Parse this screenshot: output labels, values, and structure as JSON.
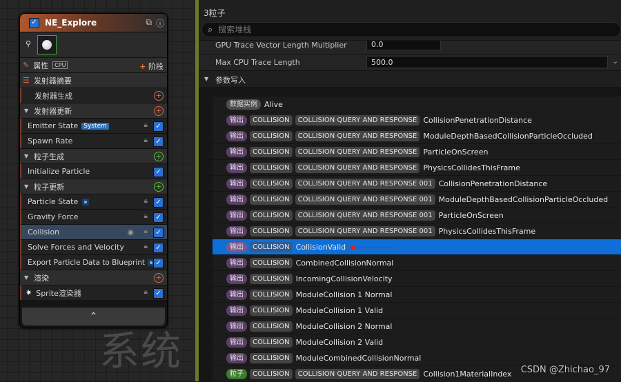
{
  "node": {
    "title": "NE_Explore",
    "properties_label": "属性",
    "cpu_label": "CPU",
    "stage_label": "阶段",
    "emitter_summary": "发射器摘要",
    "emitter_spawn": "发射器生成",
    "emitter_update": "发射器更新",
    "emitter_state": "Emitter State",
    "system_tag": "System",
    "spawn_rate": "Spawn Rate",
    "particle_spawn": "粒子生成",
    "initialize_particle": "Initialize Particle",
    "particle_update": "粒子更新",
    "particle_state": "Particle State",
    "gravity_force": "Gravity Force",
    "collision": "Collision",
    "solve_forces": "Solve Forces and Velocity",
    "export_particle": "Export Particle Data to Blueprint",
    "render": "渲染",
    "sprite_renderer": "Sprite渲染器"
  },
  "watermark": "系统",
  "panel": {
    "title": "3粒子",
    "search_placeholder": "搜索堆栈",
    "partial_label": "GPU Trace Vector Length Multiplier",
    "partial_value": "0.0",
    "max_cpu_label": "Max CPU Trace Length",
    "max_cpu_value": "500.0",
    "group_label": "参数写入"
  },
  "params": [
    {
      "ns": "数据实例",
      "cats": [],
      "name": "Alive"
    },
    {
      "ns": "输出",
      "cats": [
        "COLLISION",
        "COLLISION QUERY AND RESPONSE"
      ],
      "name": "CollisionPenetrationDistance"
    },
    {
      "ns": "输出",
      "cats": [
        "COLLISION",
        "COLLISION QUERY AND RESPONSE"
      ],
      "name": "ModuleDepthBasedCollisionParticleOccluded"
    },
    {
      "ns": "输出",
      "cats": [
        "COLLISION",
        "COLLISION QUERY AND RESPONSE"
      ],
      "name": "ParticleOnScreen"
    },
    {
      "ns": "输出",
      "cats": [
        "COLLISION",
        "COLLISION QUERY AND RESPONSE"
      ],
      "name": "PhysicsCollidesThisFrame"
    },
    {
      "ns": "输出",
      "cats": [
        "COLLISION",
        "COLLISION QUERY AND RESPONSE 001"
      ],
      "name": "CollisionPenetrationDistance"
    },
    {
      "ns": "输出",
      "cats": [
        "COLLISION",
        "COLLISION QUERY AND RESPONSE 001"
      ],
      "name": "ModuleDepthBasedCollisionParticleOccluded"
    },
    {
      "ns": "输出",
      "cats": [
        "COLLISION",
        "COLLISION QUERY AND RESPONSE 001"
      ],
      "name": "ParticleOnScreen"
    },
    {
      "ns": "输出",
      "cats": [
        "COLLISION",
        "COLLISION QUERY AND RESPONSE 001"
      ],
      "name": "PhysicsCollidesThisFrame"
    },
    {
      "ns": "输出",
      "cats": [
        "COLLISION"
      ],
      "name": "CollisionValid",
      "selected": true
    },
    {
      "ns": "输出",
      "cats": [
        "COLLISION"
      ],
      "name": "CombinedCollisionNormal"
    },
    {
      "ns": "输出",
      "cats": [
        "COLLISION"
      ],
      "name": "IncomingCollisionVelocity"
    },
    {
      "ns": "输出",
      "cats": [
        "COLLISION"
      ],
      "name": "ModuleCollision 1 Normal"
    },
    {
      "ns": "输出",
      "cats": [
        "COLLISION"
      ],
      "name": "ModuleCollision 1 Valid"
    },
    {
      "ns": "输出",
      "cats": [
        "COLLISION"
      ],
      "name": "ModuleCollision 2 Normal"
    },
    {
      "ns": "输出",
      "cats": [
        "COLLISION"
      ],
      "name": "ModuleCollision 2 Valid"
    },
    {
      "ns": "输出",
      "cats": [
        "COLLISION"
      ],
      "name": "ModuleCombinedCollisionNormal"
    },
    {
      "ns": "粒子",
      "cats": [
        "COLLISION",
        "COLLISION QUERY AND RESPONSE"
      ],
      "name": "Collision1MaterialIndex"
    }
  ],
  "csdn_label": "CSDN @Zhichao_97"
}
